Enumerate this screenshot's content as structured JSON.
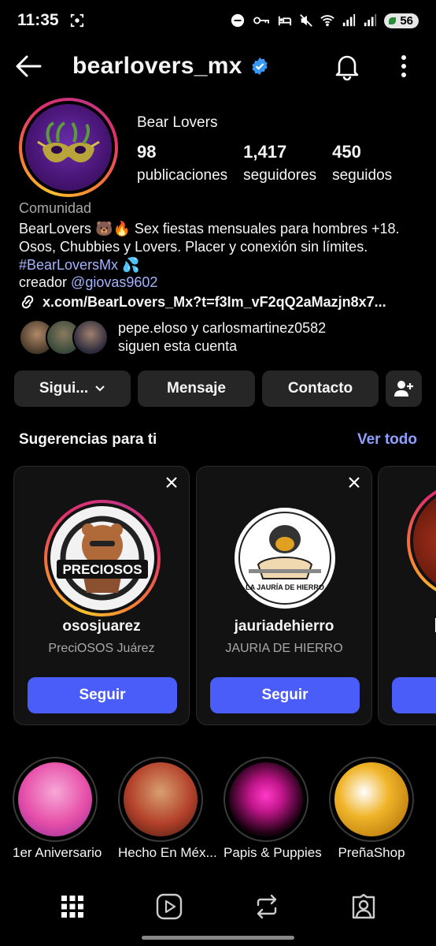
{
  "status_bar": {
    "time": "11:35",
    "battery": "56",
    "icons": [
      "screenshot-icon",
      "dnd-icon",
      "key-icon",
      "bed-icon",
      "mute-icon",
      "wifi-icon",
      "signal-icon",
      "signal-icon"
    ]
  },
  "header": {
    "username": "bearlovers_mx",
    "verified": true,
    "icons": [
      "back-arrow-icon",
      "verified-badge-icon",
      "bell-icon",
      "more-vertical-icon"
    ]
  },
  "profile": {
    "display_name": "Bear Lovers",
    "stats": [
      {
        "value": "98",
        "label": "publicaciones"
      },
      {
        "value": "1,417",
        "label": "seguidores"
      },
      {
        "value": "450",
        "label": "seguidos"
      }
    ],
    "category": "Comunidad",
    "bio_text": "BearLovers 🐻🔥 Sex fiestas mensuales para hombres +18. Osos, Chubbies y Lovers. Placer y conexión sin límites. ",
    "bio_hashtag": "#BearLoversMx",
    "bio_emoji": "💦",
    "creator_label": "creador ",
    "creator_mention": "@giovas9602",
    "link": "x.com/BearLovers_Mx?t=f3Im_vF2qQ2aMazjn8x7...",
    "followed_by_names": "pepe.eloso y carlosmartinez0582",
    "followed_by_suffix": "siguen esta cuenta"
  },
  "actions": {
    "following": "Sigui...",
    "message": "Mensaje",
    "contact": "Contacto"
  },
  "suggestions": {
    "title": "Sugerencias para ti",
    "see_all": "Ver todo",
    "cards": [
      {
        "username": "ososjuarez",
        "full_name": "PreciOSOS Juárez",
        "follow": "Seguir",
        "logo_text": "PRECIOSOS"
      },
      {
        "username": "jauriadehierro",
        "full_name": "JAURIA DE HIERRO",
        "follow": "Seguir",
        "logo_text": "LA JAURÍA DE HIERRO"
      }
    ]
  },
  "highlights": [
    {
      "label": "1er Aniversario",
      "color": "#e64fa8"
    },
    {
      "label": "Hecho En Méx...",
      "color": "#b3402a"
    },
    {
      "label": "Papis & Puppies",
      "color": "#c0168a"
    },
    {
      "label": "PreñaShop",
      "color": "#f0b429"
    }
  ],
  "bottom_nav": [
    "grid-icon",
    "reels-icon",
    "repost-icon",
    "tagged-icon"
  ],
  "colors": {
    "accent_link": "#a5b4fc",
    "follow_button": "#4a5df9",
    "see_all": "#8ea0ff",
    "button_bg": "#262626"
  }
}
